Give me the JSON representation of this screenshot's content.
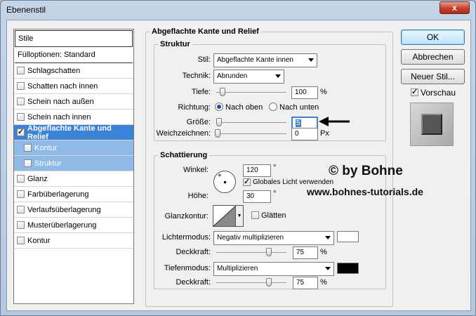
{
  "window": {
    "title": "Ebenenstil",
    "close": "x"
  },
  "styles_list": {
    "header": "Stile",
    "options": "Fülloptionen: Standard",
    "items": [
      {
        "label": "Schlagschatten",
        "checked": false
      },
      {
        "label": "Schatten nach innen",
        "checked": false
      },
      {
        "label": "Schein nach außen",
        "checked": false
      },
      {
        "label": "Schein nach innen",
        "checked": false
      },
      {
        "label": "Abgeflachte Kante und Relief",
        "checked": true
      },
      {
        "label": "Kontur",
        "checked": false
      },
      {
        "label": "Struktur",
        "checked": false
      },
      {
        "label": "Glanz",
        "checked": false
      },
      {
        "label": "Farbüberlagerung",
        "checked": false
      },
      {
        "label": "Verlaufsüberlagerung",
        "checked": false
      },
      {
        "label": "Musterüberlagerung",
        "checked": false
      },
      {
        "label": "Kontur",
        "checked": false
      }
    ]
  },
  "panel": {
    "title": "Abgeflachte Kante und Relief",
    "structure": {
      "title": "Struktur",
      "style_label": "Stil:",
      "style_value": "Abgeflachte Kante innen",
      "technique_label": "Technik:",
      "technique_value": "Abrunden",
      "depth_label": "Tiefe:",
      "depth_value": "100",
      "depth_unit": "%",
      "depth_level": 0.05,
      "direction_label": "Richtung:",
      "direction_up": "Nach oben",
      "direction_down": "Nach unten",
      "size_label": "Größe:",
      "size_value": "5",
      "size_level": 0.02,
      "soften_label": "Weichzeichnen:",
      "soften_value": "0",
      "soften_unit": "Px",
      "soften_level": 0.0
    },
    "shading": {
      "title": "Schattierung",
      "angle_label": "Winkel:",
      "angle_value": "120",
      "angle_unit": "°",
      "global_light_label": "Globales Licht verwenden",
      "altitude_label": "Höhe:",
      "altitude_value": "30",
      "altitude_unit": "°",
      "gloss_label": "Glanzkontur:",
      "antialias_label": "Glätten",
      "highlight_mode_label": "Lichtermodus:",
      "highlight_mode_value": "Negativ multiplizieren",
      "highlight_color": "#ffffff",
      "highlight_opacity_label": "Deckkraft:",
      "highlight_opacity_value": "75",
      "highlight_opacity_unit": "%",
      "highlight_level": 0.75,
      "shadow_mode_label": "Tiefenmodus:",
      "shadow_mode_value": "Multiplizieren",
      "shadow_color": "#000000",
      "shadow_opacity_label": "Deckkraft:",
      "shadow_opacity_value": "75",
      "shadow_opacity_unit": "%",
      "shadow_level": 0.75
    }
  },
  "buttons": {
    "ok": "OK",
    "cancel": "Abbrechen",
    "new_style": "Neuer Stil...",
    "preview": "Vorschau"
  },
  "watermark": {
    "line1": "© by Bohne",
    "line2": "www.bohnes-tutorials.de"
  }
}
